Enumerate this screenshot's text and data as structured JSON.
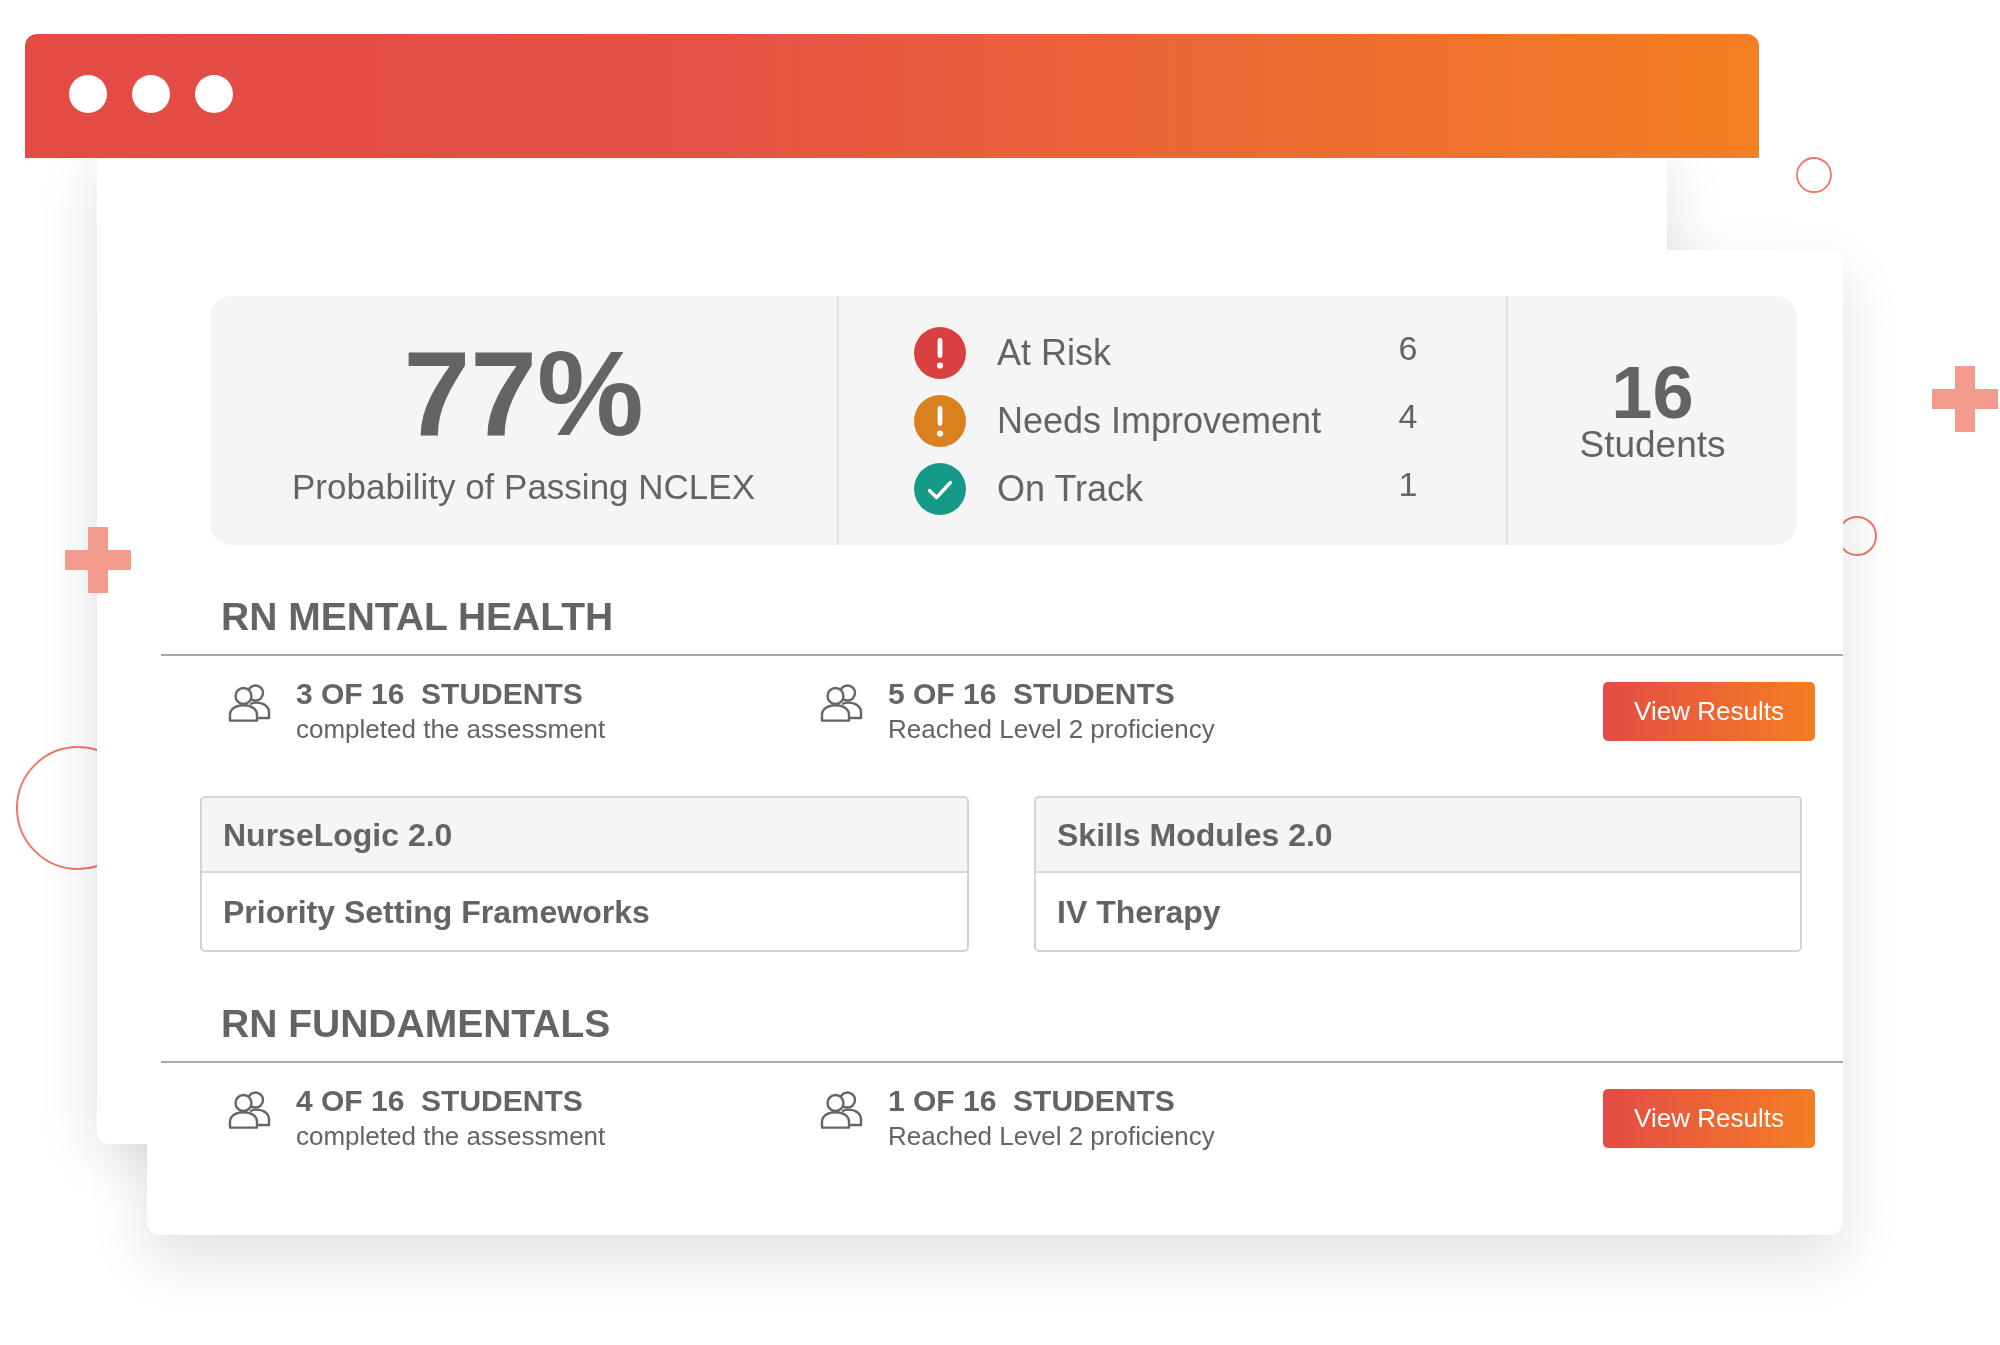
{
  "summary": {
    "probability": {
      "value": "77%",
      "label": "Probability of Passing NCLEX"
    },
    "statuses": [
      {
        "kind": "alert",
        "label": "At Risk",
        "count": "6",
        "color": "#d94140"
      },
      {
        "kind": "alert",
        "label": "Needs Improvement",
        "count": "4",
        "color": "#d9801f"
      },
      {
        "kind": "check",
        "label": "On Track",
        "count": "1",
        "color": "#169a88"
      }
    ],
    "total": {
      "value": "16",
      "label": "Students"
    }
  },
  "sections": [
    {
      "title": "RN MENTAL HEALTH",
      "stats": [
        {
          "value": "3 OF 16  STUDENTS",
          "caption": "completed the assessment"
        },
        {
          "value": "5 OF 16  STUDENTS",
          "caption": "Reached Level 2 proficiency"
        }
      ],
      "button": "View Results",
      "modules": [
        {
          "title": "NurseLogic 2.0",
          "topic": "Priority Setting Frameworks"
        },
        {
          "title": "Skills Modules 2.0",
          "topic": "IV Therapy"
        }
      ]
    },
    {
      "title": "RN FUNDAMENTALS",
      "stats": [
        {
          "value": "4 OF 16  STUDENTS",
          "caption": "completed the assessment"
        },
        {
          "value": "1 OF 16  STUDENTS",
          "caption": "Reached Level 2 proficiency"
        }
      ],
      "button": "View Results"
    }
  ]
}
